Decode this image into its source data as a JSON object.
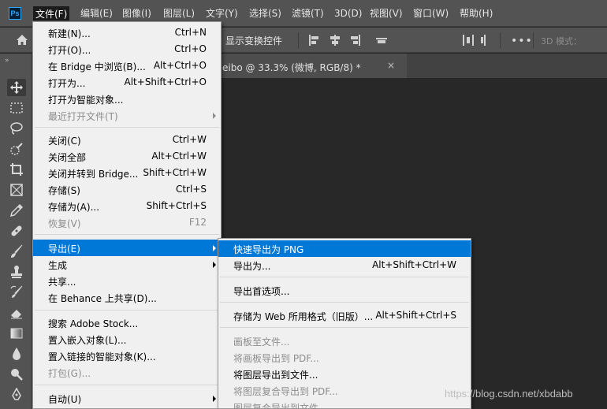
{
  "app": {
    "logo": "Ps"
  },
  "menubar": [
    "文件(F)",
    "编辑(E)",
    "图像(I)",
    "图层(L)",
    "文字(Y)",
    "选择(S)",
    "滤镜(T)",
    "3D(D)",
    "视图(V)",
    "窗口(W)",
    "帮助(H)"
  ],
  "options": {
    "show_transform": "显示变换控件",
    "more": "•••",
    "mode3d": "3D 模式："
  },
  "document": {
    "tab_title": "eibo @ 33.3% (微博, RGB/8) *",
    "close": "×"
  },
  "file_menu": {
    "items": [
      {
        "label": "新建(N)...",
        "shortcut": "Ctrl+N"
      },
      {
        "label": "打开(O)...",
        "shortcut": "Ctrl+O"
      },
      {
        "label": "在 Bridge 中浏览(B)...",
        "shortcut": "Alt+Ctrl+O"
      },
      {
        "label": "打开为...",
        "shortcut": "Alt+Shift+Ctrl+O"
      },
      {
        "label": "打开为智能对象...",
        "shortcut": ""
      },
      {
        "label": "最近打开文件(T)",
        "shortcut": ""
      },
      {
        "label": "关闭(C)",
        "shortcut": "Ctrl+W"
      },
      {
        "label": "关闭全部",
        "shortcut": "Alt+Ctrl+W"
      },
      {
        "label": "关闭并转到 Bridge...",
        "shortcut": "Shift+Ctrl+W"
      },
      {
        "label": "存储(S)",
        "shortcut": "Ctrl+S"
      },
      {
        "label": "存储为(A)...",
        "shortcut": "Shift+Ctrl+S"
      },
      {
        "label": "恢复(V)",
        "shortcut": "F12"
      },
      {
        "label": "导出(E)",
        "shortcut": ""
      },
      {
        "label": "生成",
        "shortcut": ""
      },
      {
        "label": "共享...",
        "shortcut": ""
      },
      {
        "label": "在 Behance 上共享(D)...",
        "shortcut": ""
      },
      {
        "label": "搜索 Adobe Stock...",
        "shortcut": ""
      },
      {
        "label": "置入嵌入对象(L)...",
        "shortcut": ""
      },
      {
        "label": "置入链接的智能对象(K)...",
        "shortcut": ""
      },
      {
        "label": "打包(G)...",
        "shortcut": ""
      },
      {
        "label": "自动(U)",
        "shortcut": ""
      }
    ]
  },
  "export_menu": {
    "items": [
      {
        "label": "快速导出为 PNG",
        "shortcut": ""
      },
      {
        "label": "导出为...",
        "shortcut": "Alt+Shift+Ctrl+W"
      },
      {
        "label": "导出首选项...",
        "shortcut": ""
      },
      {
        "label": "存储为 Web 所用格式（旧版）...",
        "shortcut": "Alt+Shift+Ctrl+S"
      },
      {
        "label": "画板至文件...",
        "shortcut": ""
      },
      {
        "label": "将画板导出到 PDF...",
        "shortcut": ""
      },
      {
        "label": "将图层导出到文件...",
        "shortcut": ""
      },
      {
        "label": "将图层复合导出到 PDF...",
        "shortcut": ""
      },
      {
        "label": "图层复合导出到文件...",
        "shortcut": ""
      }
    ]
  },
  "watermark": "https://blog.csdn.net/xbdabb"
}
